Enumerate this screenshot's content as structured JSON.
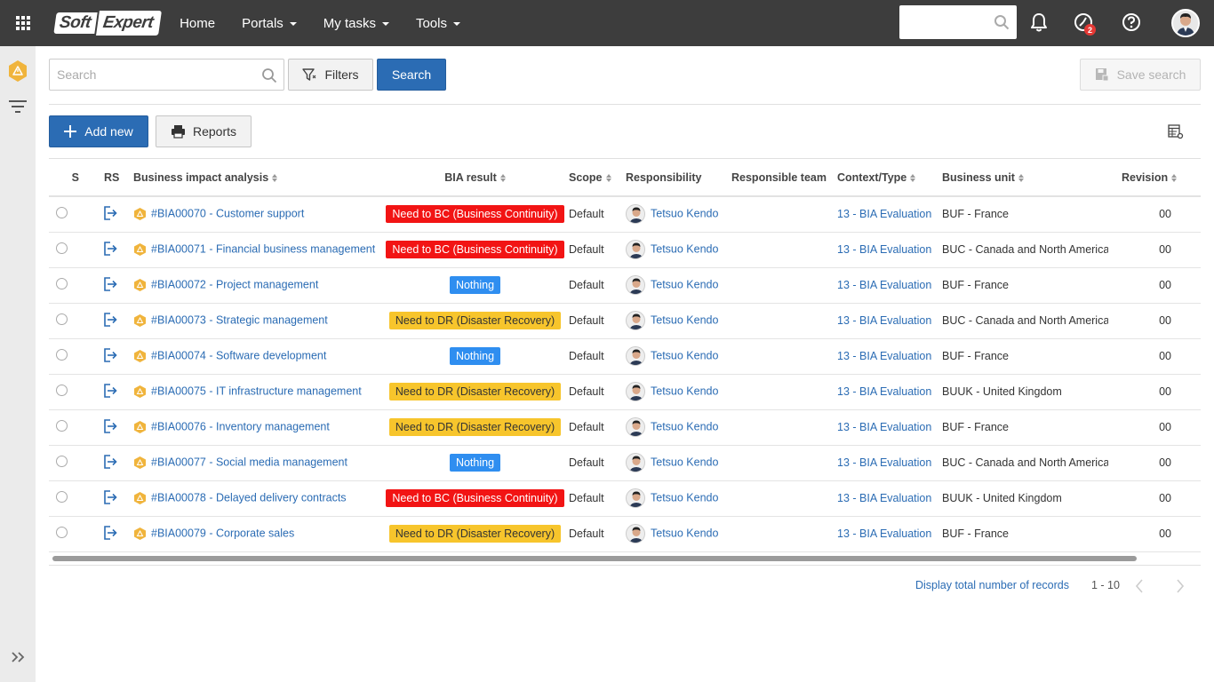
{
  "topbar": {
    "logo_left": "Soft",
    "logo_right": "Expert",
    "nav": [
      {
        "label": "Home",
        "has_caret": false
      },
      {
        "label": "Portals",
        "has_caret": true
      },
      {
        "label": "My tasks",
        "has_caret": true
      },
      {
        "label": "Tools",
        "has_caret": true
      }
    ],
    "notification_badge": "2"
  },
  "toolbar": {
    "search_placeholder": "Search",
    "filters_label": "Filters",
    "search_label": "Search",
    "save_search_label": "Save search",
    "add_new_label": "Add new",
    "reports_label": "Reports"
  },
  "table": {
    "columns": {
      "s": "S",
      "rs": "RS",
      "bia": "Business impact analysis",
      "result": "BIA result",
      "scope": "Scope",
      "responsibility": "Responsibility",
      "team": "Responsible team",
      "context": "Context/Type",
      "unit": "Business unit",
      "revision": "Revision"
    },
    "rows": [
      {
        "bia": "#BIA00070 - Customer support",
        "result": "Need to BC (Business Continuity)",
        "result_color": "red",
        "scope": "Default",
        "responsibility": "Tetsuo Kendo",
        "context": "13 - BIA Evaluation",
        "unit": "BUF - France",
        "revision": "00"
      },
      {
        "bia": "#BIA00071 - Financial business management",
        "result": "Need to BC (Business Continuity)",
        "result_color": "red",
        "scope": "Default",
        "responsibility": "Tetsuo Kendo",
        "context": "13 - BIA Evaluation",
        "unit": "BUC - Canada and North America",
        "revision": "00"
      },
      {
        "bia": "#BIA00072 - Project management",
        "result": "Nothing",
        "result_color": "blue",
        "scope": "Default",
        "responsibility": "Tetsuo Kendo",
        "context": "13 - BIA Evaluation",
        "unit": "BUF - France",
        "revision": "00"
      },
      {
        "bia": "#BIA00073 - Strategic management",
        "result": "Need to DR (Disaster Recovery)",
        "result_color": "yellow",
        "scope": "Default",
        "responsibility": "Tetsuo Kendo",
        "context": "13 - BIA Evaluation",
        "unit": "BUC - Canada and North America",
        "revision": "00"
      },
      {
        "bia": "#BIA00074 - Software development",
        "result": "Nothing",
        "result_color": "blue",
        "scope": "Default",
        "responsibility": "Tetsuo Kendo",
        "context": "13 - BIA Evaluation",
        "unit": "BUF - France",
        "revision": "00"
      },
      {
        "bia": "#BIA00075 - IT infrastructure management",
        "result": "Need to DR (Disaster Recovery)",
        "result_color": "yellow",
        "scope": "Default",
        "responsibility": "Tetsuo Kendo",
        "context": "13 - BIA Evaluation",
        "unit": "BUUK - United Kingdom",
        "revision": "00"
      },
      {
        "bia": "#BIA00076 - Inventory management",
        "result": "Need to DR (Disaster Recovery)",
        "result_color": "yellow",
        "scope": "Default",
        "responsibility": "Tetsuo Kendo",
        "context": "13 - BIA Evaluation",
        "unit": "BUF - France",
        "revision": "00"
      },
      {
        "bia": "#BIA00077 - Social media management",
        "result": "Nothing",
        "result_color": "blue",
        "scope": "Default",
        "responsibility": "Tetsuo Kendo",
        "context": "13 - BIA Evaluation",
        "unit": "BUC - Canada and North America",
        "revision": "00"
      },
      {
        "bia": "#BIA00078 - Delayed delivery contracts",
        "result": "Need to BC (Business Continuity)",
        "result_color": "red",
        "scope": "Default",
        "responsibility": "Tetsuo Kendo",
        "context": "13 - BIA Evaluation",
        "unit": "BUUK - United Kingdom",
        "revision": "00"
      },
      {
        "bia": "#BIA00079 - Corporate sales",
        "result": "Need to DR (Disaster Recovery)",
        "result_color": "yellow",
        "scope": "Default",
        "responsibility": "Tetsuo Kendo",
        "context": "13 - BIA Evaluation",
        "unit": "BUF - France",
        "revision": "00"
      }
    ]
  },
  "footer": {
    "display_total_label": "Display total number of records",
    "range": "1 - 10"
  },
  "colors": {
    "accent": "#2b6cb4",
    "topbar": "#3d3d3d",
    "red": "#f21414",
    "yellow": "#f7c52c",
    "blue": "#2f8ef0",
    "warning_icon": "#f0b43c"
  }
}
